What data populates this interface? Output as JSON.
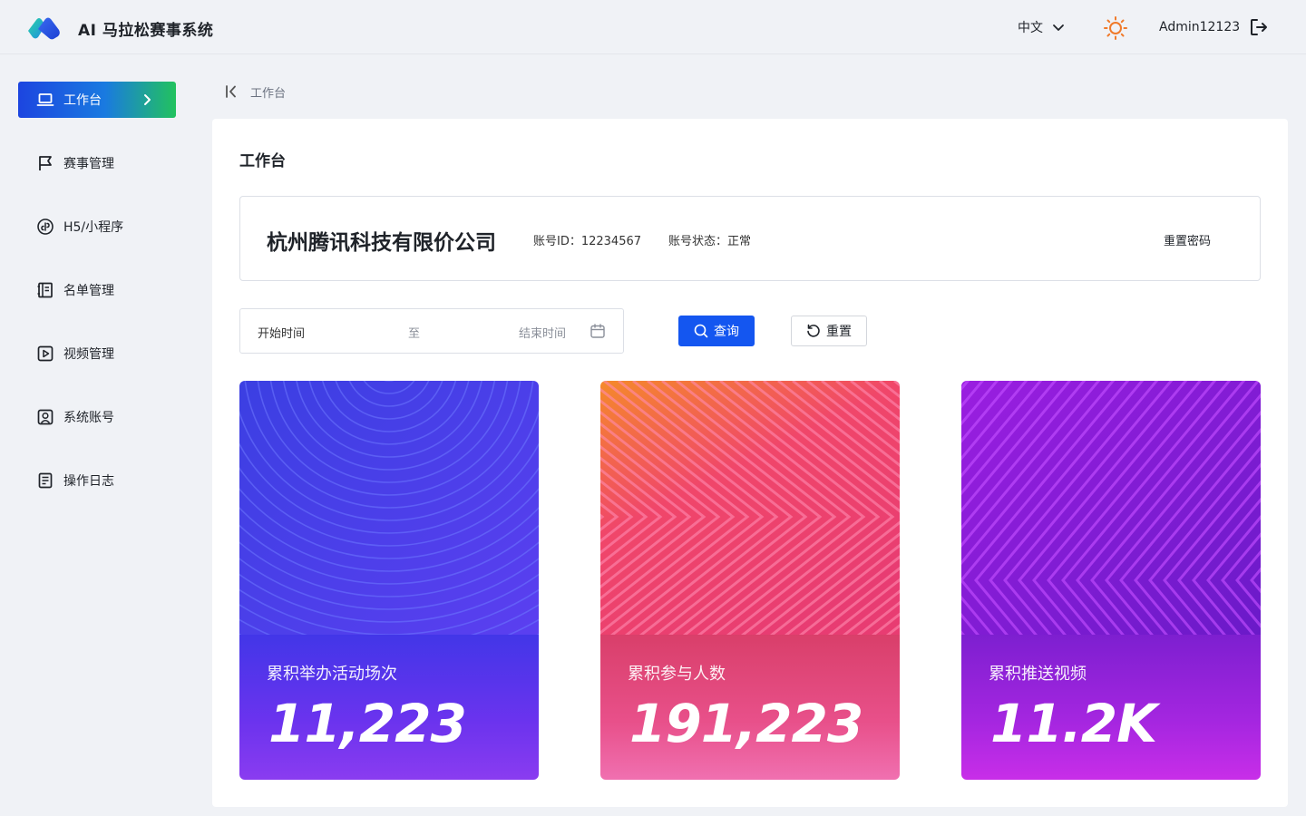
{
  "header": {
    "app_title": "AI 马拉松赛事系统",
    "language": "中文",
    "username": "Admin12123",
    "icons": [
      "logo-icon",
      "chevron-down-icon",
      "sun-icon",
      "logout-icon"
    ]
  },
  "sidebar": {
    "items": [
      {
        "label": "工作台",
        "icon": "laptop-icon",
        "active": true
      },
      {
        "label": "赛事管理",
        "icon": "flag-icon"
      },
      {
        "label": "H5/小程序",
        "icon": "link-icon"
      },
      {
        "label": "名单管理",
        "icon": "notebook-icon"
      },
      {
        "label": "视频管理",
        "icon": "play-icon"
      },
      {
        "label": "系统账号",
        "icon": "user-card-icon"
      },
      {
        "label": "操作日志",
        "icon": "document-icon"
      }
    ]
  },
  "breadcrumb": {
    "current": "工作台"
  },
  "main": {
    "title": "工作台",
    "account": {
      "company": "杭州腾讯科技有限价公司",
      "id_text": "账号ID：12234567",
      "status_text": "账号状态：正常",
      "reset_password": "重置密码"
    },
    "filter": {
      "start_placeholder": "开始时间",
      "to_text": "至",
      "end_placeholder": "结束时间",
      "query_label": "查询",
      "reset_label": "重置"
    },
    "stats": [
      {
        "label": "累积举办活动场次",
        "value": "11,223"
      },
      {
        "label": "累积参与人数",
        "value": "191,223"
      },
      {
        "label": "累积推送视频",
        "value": "11.2K"
      }
    ]
  },
  "colors": {
    "accent": "#1456f0",
    "card1": "#4a3be8",
    "card2": "#f0547a",
    "card3": "#a524e8"
  }
}
